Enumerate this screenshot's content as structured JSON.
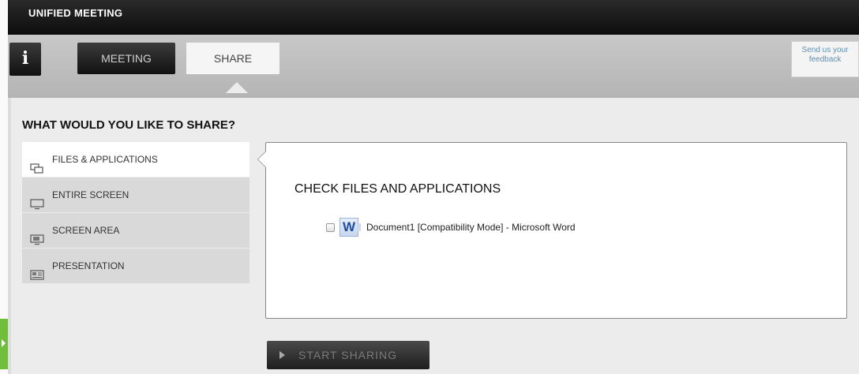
{
  "app": {
    "title": "UNIFIED MEETING"
  },
  "toolbar": {
    "info_label": "i",
    "tabs": [
      {
        "label": "MEETING",
        "active": false
      },
      {
        "label": "SHARE",
        "active": true
      }
    ],
    "feedback": {
      "line1": "Send us your",
      "line2": "feedback"
    }
  },
  "share": {
    "heading": "WHAT WOULD YOU LIKE TO SHARE?",
    "menu": [
      {
        "label": "FILES & APPLICATIONS",
        "icon": "windows-icon",
        "active": true
      },
      {
        "label": "ENTIRE SCREEN",
        "icon": "monitor-icon",
        "active": false
      },
      {
        "label": "SCREEN AREA",
        "icon": "screen-area-icon",
        "active": false
      },
      {
        "label": "PRESENTATION",
        "icon": "presentation-icon",
        "active": false
      }
    ],
    "content": {
      "title": "CHECK FILES AND APPLICATIONS",
      "files": [
        {
          "label": "Document1 [Compatibility Mode] - Microsoft Word",
          "icon": "word-icon",
          "icon_text": "W",
          "checked": false
        }
      ]
    },
    "start_button": "START SHARING"
  },
  "colors": {
    "titlebar": "#111111",
    "panel": "#ececec",
    "feedback_text": "#5f90b8",
    "handle": "#6fbf3a"
  }
}
